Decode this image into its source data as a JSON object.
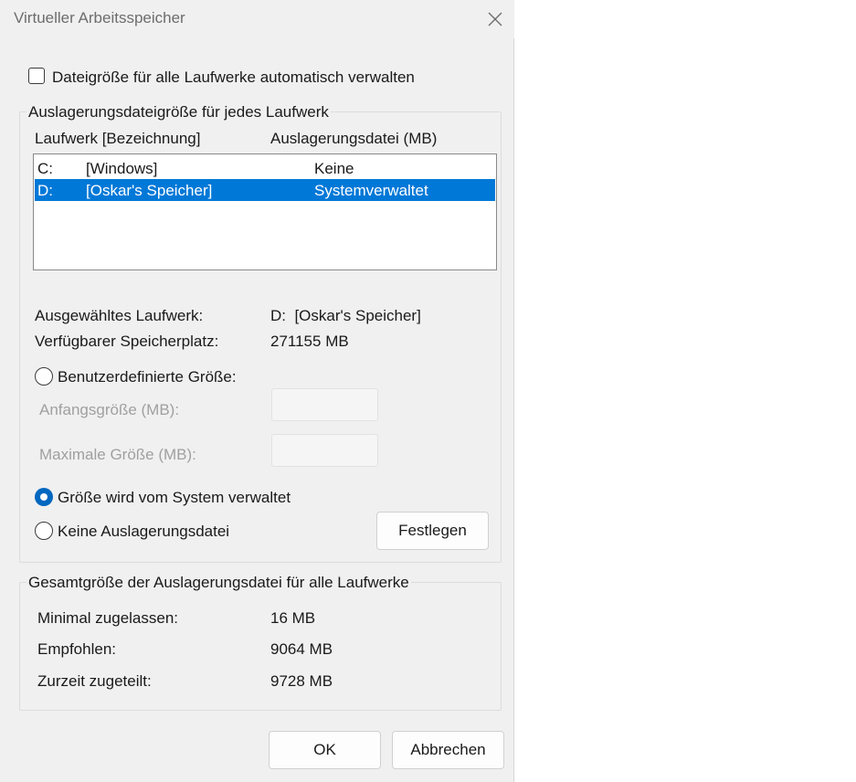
{
  "window": {
    "title": "Virtueller Arbeitsspeicher"
  },
  "auto_manage": {
    "label": "Dateigröße für alle Laufwerke automatisch verwalten",
    "checked": false
  },
  "per_drive": {
    "group_label": "Auslagerungsdateigröße für jedes Laufwerk",
    "col_drive": "Laufwerk [Bezeichnung]",
    "col_pagefile": "Auslagerungsdatei (MB)",
    "rows": [
      {
        "letter": "C:",
        "label": "[Windows]",
        "pagefile": "Keine",
        "selected": false
      },
      {
        "letter": "D:",
        "label": "[Oskar's Speicher]",
        "pagefile": "Systemverwaltet",
        "selected": true
      }
    ],
    "selected_drive_label": "Ausgewähltes Laufwerk:",
    "selected_drive_value": "D:  [Oskar's Speicher]",
    "free_space_label": "Verfügbarer Speicherplatz:",
    "free_space_value": "271155 MB",
    "custom_size_label": "Benutzerdefinierte Größe:",
    "initial_size_label": "Anfangsgröße (MB):",
    "max_size_label": "Maximale Größe (MB):",
    "system_managed_label": "Größe wird vom System verwaltet",
    "no_pagefile_label": "Keine Auslagerungsdatei",
    "set_button": "Festlegen",
    "selected_option": "system_managed"
  },
  "totals": {
    "group_label": "Gesamtgröße der Auslagerungsdatei für alle Laufwerke",
    "min_label": "Minimal zugelassen:",
    "min_value": "16 MB",
    "recommended_label": "Empfohlen:",
    "recommended_value": "9064 MB",
    "current_label": "Zurzeit zugeteilt:",
    "current_value": "9728 MB"
  },
  "buttons": {
    "ok": "OK",
    "cancel": "Abbrechen"
  },
  "colors": {
    "accent": "#0067c0",
    "selection": "#0078d7"
  }
}
